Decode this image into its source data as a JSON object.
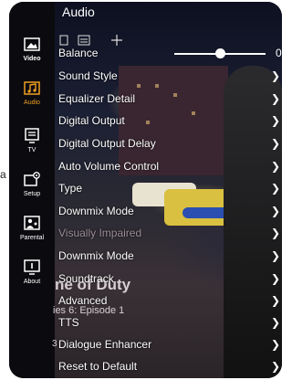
{
  "header": {
    "title": "Audio"
  },
  "sidebar": {
    "items": [
      {
        "label": "Video",
        "icon": "video-icon"
      },
      {
        "label": "Audio",
        "icon": "audio-icon",
        "active": true
      },
      {
        "label": "TV",
        "icon": "tv-icon"
      },
      {
        "label": "Setup",
        "icon": "setup-icon"
      },
      {
        "label": "Parental",
        "icon": "parental-icon"
      },
      {
        "label": "About",
        "icon": "about-icon"
      }
    ]
  },
  "balance": {
    "label": "Balance",
    "value": "0"
  },
  "menu": {
    "items": [
      {
        "label": "Sound Style"
      },
      {
        "label": "Equalizer Detail"
      },
      {
        "label": "Digital Output"
      },
      {
        "label": "Digital Output Delay"
      },
      {
        "label": "Auto Volume Control"
      },
      {
        "label": "Type"
      },
      {
        "label": "Downmix Mode"
      },
      {
        "label": "Visually Impaired",
        "disabled": true
      },
      {
        "label": "Downmix Mode"
      },
      {
        "label": "Soundtrack"
      },
      {
        "label": "Advanced"
      },
      {
        "label": "TTS"
      },
      {
        "label": "Dialogue Enhancer"
      },
      {
        "label": "Reset to Default"
      }
    ]
  },
  "overlay": {
    "program_title": "ne of Duty",
    "episode": "ies 6: Episode 1",
    "stray_digit": "3",
    "page_edge_char": "a"
  },
  "colors": {
    "accent": "#f0a020",
    "sidebar_bg": "#0b0b0f",
    "text": "#ffffff"
  }
}
